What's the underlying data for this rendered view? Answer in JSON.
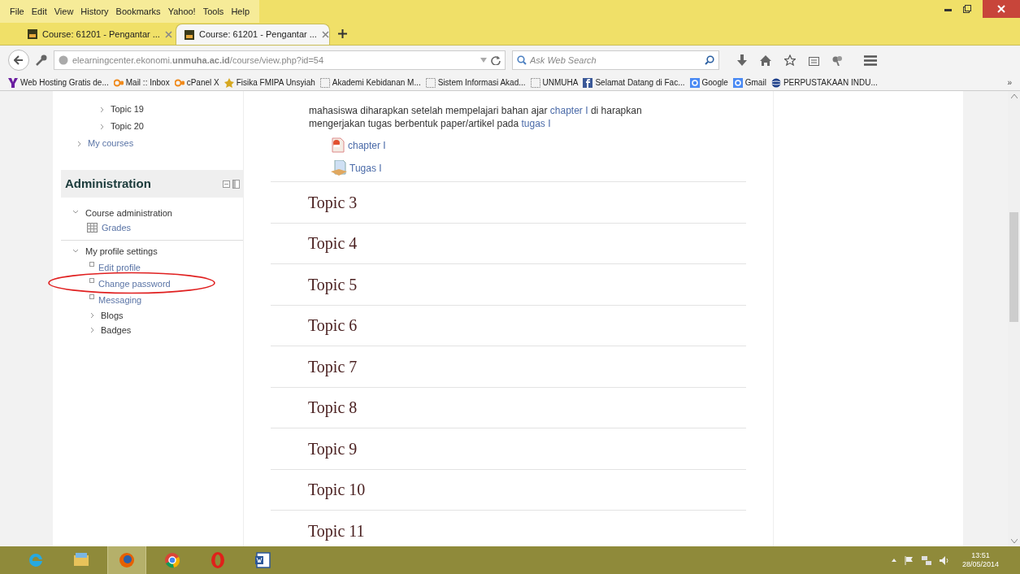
{
  "menu": [
    "File",
    "Edit",
    "View",
    "History",
    "Bookmarks",
    "Yahoo!",
    "Tools",
    "Help"
  ],
  "tabs": [
    {
      "title": "Course: 61201 - Pengantar ...",
      "selected": false
    },
    {
      "title": "Course: 61201 - Pengantar ...",
      "selected": true
    }
  ],
  "address_bar": {
    "url": "elearningcenter.ekonomi.**unmuha.ac.id**/course/view.php?id=54"
  },
  "search": {
    "placeholder": "Ask Web Search"
  },
  "bookmarks": [
    {
      "label": "Web Hosting Gratis de...",
      "kind": "yahoo"
    },
    {
      "label": "Mail :: Inbox",
      "kind": "cpanel"
    },
    {
      "label": "cPanel X",
      "kind": "cpanel"
    },
    {
      "label": "Fisika FMIPA Unsyiah",
      "kind": "emblem"
    },
    {
      "label": "Akademi Kebidanan M...",
      "kind": "blank"
    },
    {
      "label": "Sistem Informasi Akad...",
      "kind": "blank"
    },
    {
      "label": "UNMUHA",
      "kind": "blank"
    },
    {
      "label": "Selamat Datang di Fac...",
      "kind": "facebook"
    },
    {
      "label": "Google",
      "kind": "google"
    },
    {
      "label": "Gmail",
      "kind": "google"
    },
    {
      "label": "PERPUSTAKAAN INDU...",
      "kind": "globe"
    }
  ],
  "bookmarks_overflow": "»",
  "navigation": {
    "topics": [
      "Topic 19",
      "Topic 20"
    ],
    "my_courses": "My courses"
  },
  "administration": {
    "title": "Administration",
    "sections": [
      {
        "label": "Course administration",
        "expanded": true,
        "children": [
          {
            "label": "Grades",
            "kind": "grades"
          }
        ]
      },
      {
        "label": "My profile settings",
        "expanded": true,
        "children": [
          {
            "label": "Edit profile",
            "kind": "leaf"
          },
          {
            "label": "Change password",
            "kind": "leaf"
          },
          {
            "label": "Messaging",
            "kind": "leaf"
          },
          {
            "label": "Blogs",
            "kind": "branch"
          },
          {
            "label": "Badges",
            "kind": "branch"
          }
        ]
      }
    ]
  },
  "content": {
    "paragraph": [
      {
        "text": "mahasiswa diharapkan setelah mempelajari bahan ajar ",
        "link": false
      },
      {
        "text": "chapter I",
        "link": true
      },
      {
        "text": " di harapkan mengerjakan tugas berbentuk paper/artikel pada ",
        "link": false
      },
      {
        "text": "tugas I",
        "link": true
      }
    ],
    "activities": [
      {
        "label": "chapter I",
        "kind": "pdf"
      },
      {
        "label": "Tugas I",
        "kind": "assignment"
      }
    ],
    "topics": [
      "Topic 3",
      "Topic 4",
      "Topic 5",
      "Topic 6",
      "Topic 7",
      "Topic 8",
      "Topic 9",
      "Topic 10",
      "Topic 11"
    ]
  },
  "taskbar": {
    "apps": [
      {
        "kind": "ie",
        "selected": false
      },
      {
        "kind": "explorer",
        "selected": false
      },
      {
        "kind": "firefox",
        "selected": true
      },
      {
        "kind": "chrome",
        "selected": false
      },
      {
        "kind": "opera",
        "selected": false
      },
      {
        "kind": "word",
        "selected": false
      }
    ],
    "time": "13:51",
    "date": "28/05/2014"
  }
}
